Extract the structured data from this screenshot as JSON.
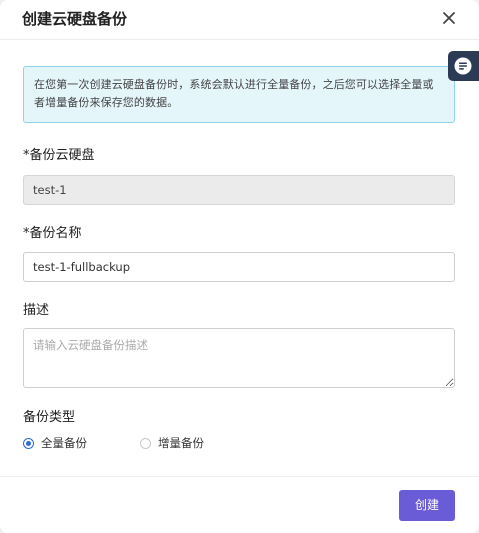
{
  "dialog": {
    "title": "创建云硬盘备份",
    "close_icon": "close-icon",
    "notice": "在您第一次创建云硬盘备份时，系统会默认进行全量备份，之后您可以选择全量或者增量备份来保存您的数据。",
    "fields": {
      "volume": {
        "label": "*备份云硬盘",
        "value": "test-1"
      },
      "name": {
        "label": "*备份名称",
        "value": "test-1-fullbackup"
      },
      "description": {
        "label": "描述",
        "placeholder": "请输入云硬盘备份描述",
        "value": ""
      },
      "backup_type": {
        "label": "备份类型",
        "options": [
          {
            "label": "全量备份",
            "checked": true
          },
          {
            "label": "增量备份",
            "checked": false
          }
        ]
      }
    },
    "footer": {
      "create_label": "创建"
    },
    "side_tab_icon": "chat-icon"
  },
  "colors": {
    "accent": "#6a5bd6",
    "radio_checked": "#2f6bd8",
    "notice_bg": "#e5f6fb",
    "notice_border": "#8fd3ec",
    "side_tab": "#2b3a55"
  }
}
